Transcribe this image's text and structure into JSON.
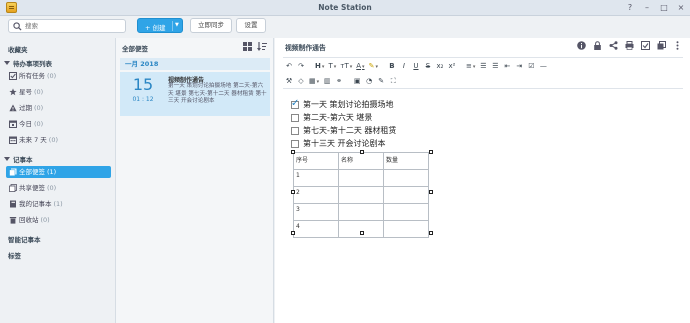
{
  "window": {
    "title": "Note Station",
    "controls": [
      "?",
      "–",
      "□",
      "×"
    ]
  },
  "toolbar": {
    "search_placeholder": "搜索",
    "create_label": "+ 创建",
    "sync_label": "立即同步",
    "settings_label": "设置"
  },
  "sidebar": {
    "favorites": "收藏夹",
    "todo_group": "待办事项列表",
    "todo_items": [
      {
        "label": "所有任务",
        "count": "(0)",
        "icon": "checkbox-icon"
      },
      {
        "label": "星号",
        "count": "(0)",
        "icon": "star-icon"
      },
      {
        "label": "过期",
        "count": "(0)",
        "icon": "alert-icon"
      },
      {
        "label": "今日",
        "count": "(0)",
        "icon": "calendar-today-icon"
      },
      {
        "label": "未来 7 天",
        "count": "(0)",
        "icon": "calendar-week-icon"
      }
    ],
    "notebook_group": "记事本",
    "notebook_items": [
      {
        "label": "全部便签",
        "count": "(1)",
        "icon": "all-notes-icon",
        "active": true
      },
      {
        "label": "共享便签",
        "count": "(0)",
        "icon": "shared-icon"
      },
      {
        "label": "我的记事本",
        "count": "(1)",
        "icon": "notebook-icon"
      },
      {
        "label": "回收站",
        "count": "(0)",
        "icon": "trash-icon"
      }
    ],
    "smart_notebooks": "智能记事本",
    "tags": "标签"
  },
  "note_list": {
    "header": "全部便签",
    "month": "一月 2018",
    "notes": [
      {
        "day": "15",
        "time": "01 : 12",
        "title": "视频制作通告",
        "snippet": "第一天 策划讨论拍摄场地 第二天-第六天 堪景 第七天-第十二天 器材租赁 第十三天 开会讨论剧本"
      }
    ]
  },
  "editor": {
    "title": "视频制作通告",
    "format_row1": [
      "↶",
      "↷",
      "H",
      "T",
      "ᴛT",
      "A",
      "✎",
      "B",
      "I",
      "U",
      "S",
      "x₂",
      "x²",
      "≡",
      "☰",
      "☰",
      "⇤",
      "⇥",
      "☑",
      "—"
    ],
    "format_row2": [
      "⚒",
      "◇",
      "▦",
      "▥",
      "⚭",
      "▣",
      "◔",
      "✎",
      "⛶"
    ],
    "checklist": [
      {
        "text": "第一天 策划讨论拍摄场地",
        "checked": true
      },
      {
        "text": "第二天-第六天 堪景",
        "checked": false
      },
      {
        "text": "第七天-第十二天 器材租赁",
        "checked": false
      },
      {
        "text": "第十三天 开会讨论剧本",
        "checked": false
      }
    ],
    "table": {
      "headers": [
        "序号",
        "名称",
        "数量"
      ],
      "rows": [
        [
          "1",
          "",
          ""
        ],
        [
          "2",
          "",
          ""
        ],
        [
          "3",
          "",
          ""
        ],
        [
          "4",
          "",
          ""
        ]
      ]
    }
  },
  "colors": {
    "accent": "#2fa4e7",
    "titlebar": "#dfe6ee",
    "selected_card": "#d2e9f8"
  }
}
